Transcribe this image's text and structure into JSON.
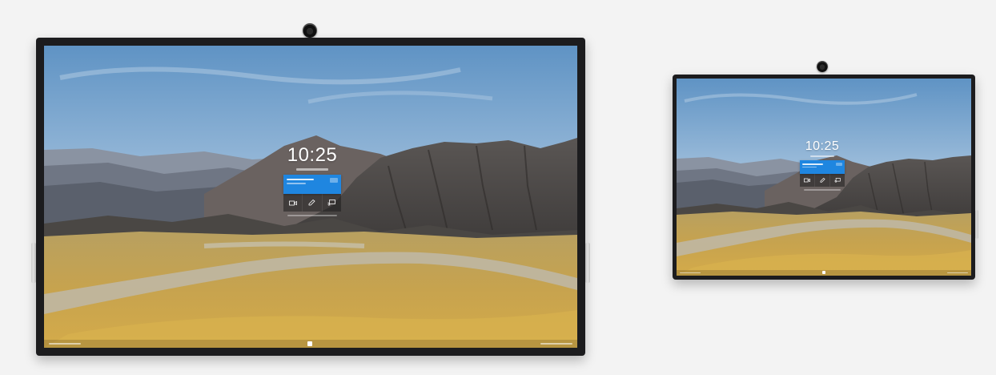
{
  "devices": [
    {
      "size": "large",
      "lock_screen": {
        "time": "10:25",
        "actions": [
          "camera-icon",
          "whiteboard-icon",
          "cast-icon"
        ]
      }
    },
    {
      "size": "small",
      "lock_screen": {
        "time": "10:25",
        "actions": [
          "camera-icon",
          "whiteboard-icon",
          "cast-icon"
        ]
      }
    }
  ],
  "colors": {
    "background": "#f3f3f3",
    "bezel": "#1c1c1e",
    "meeting_card": "#1f86e0"
  }
}
